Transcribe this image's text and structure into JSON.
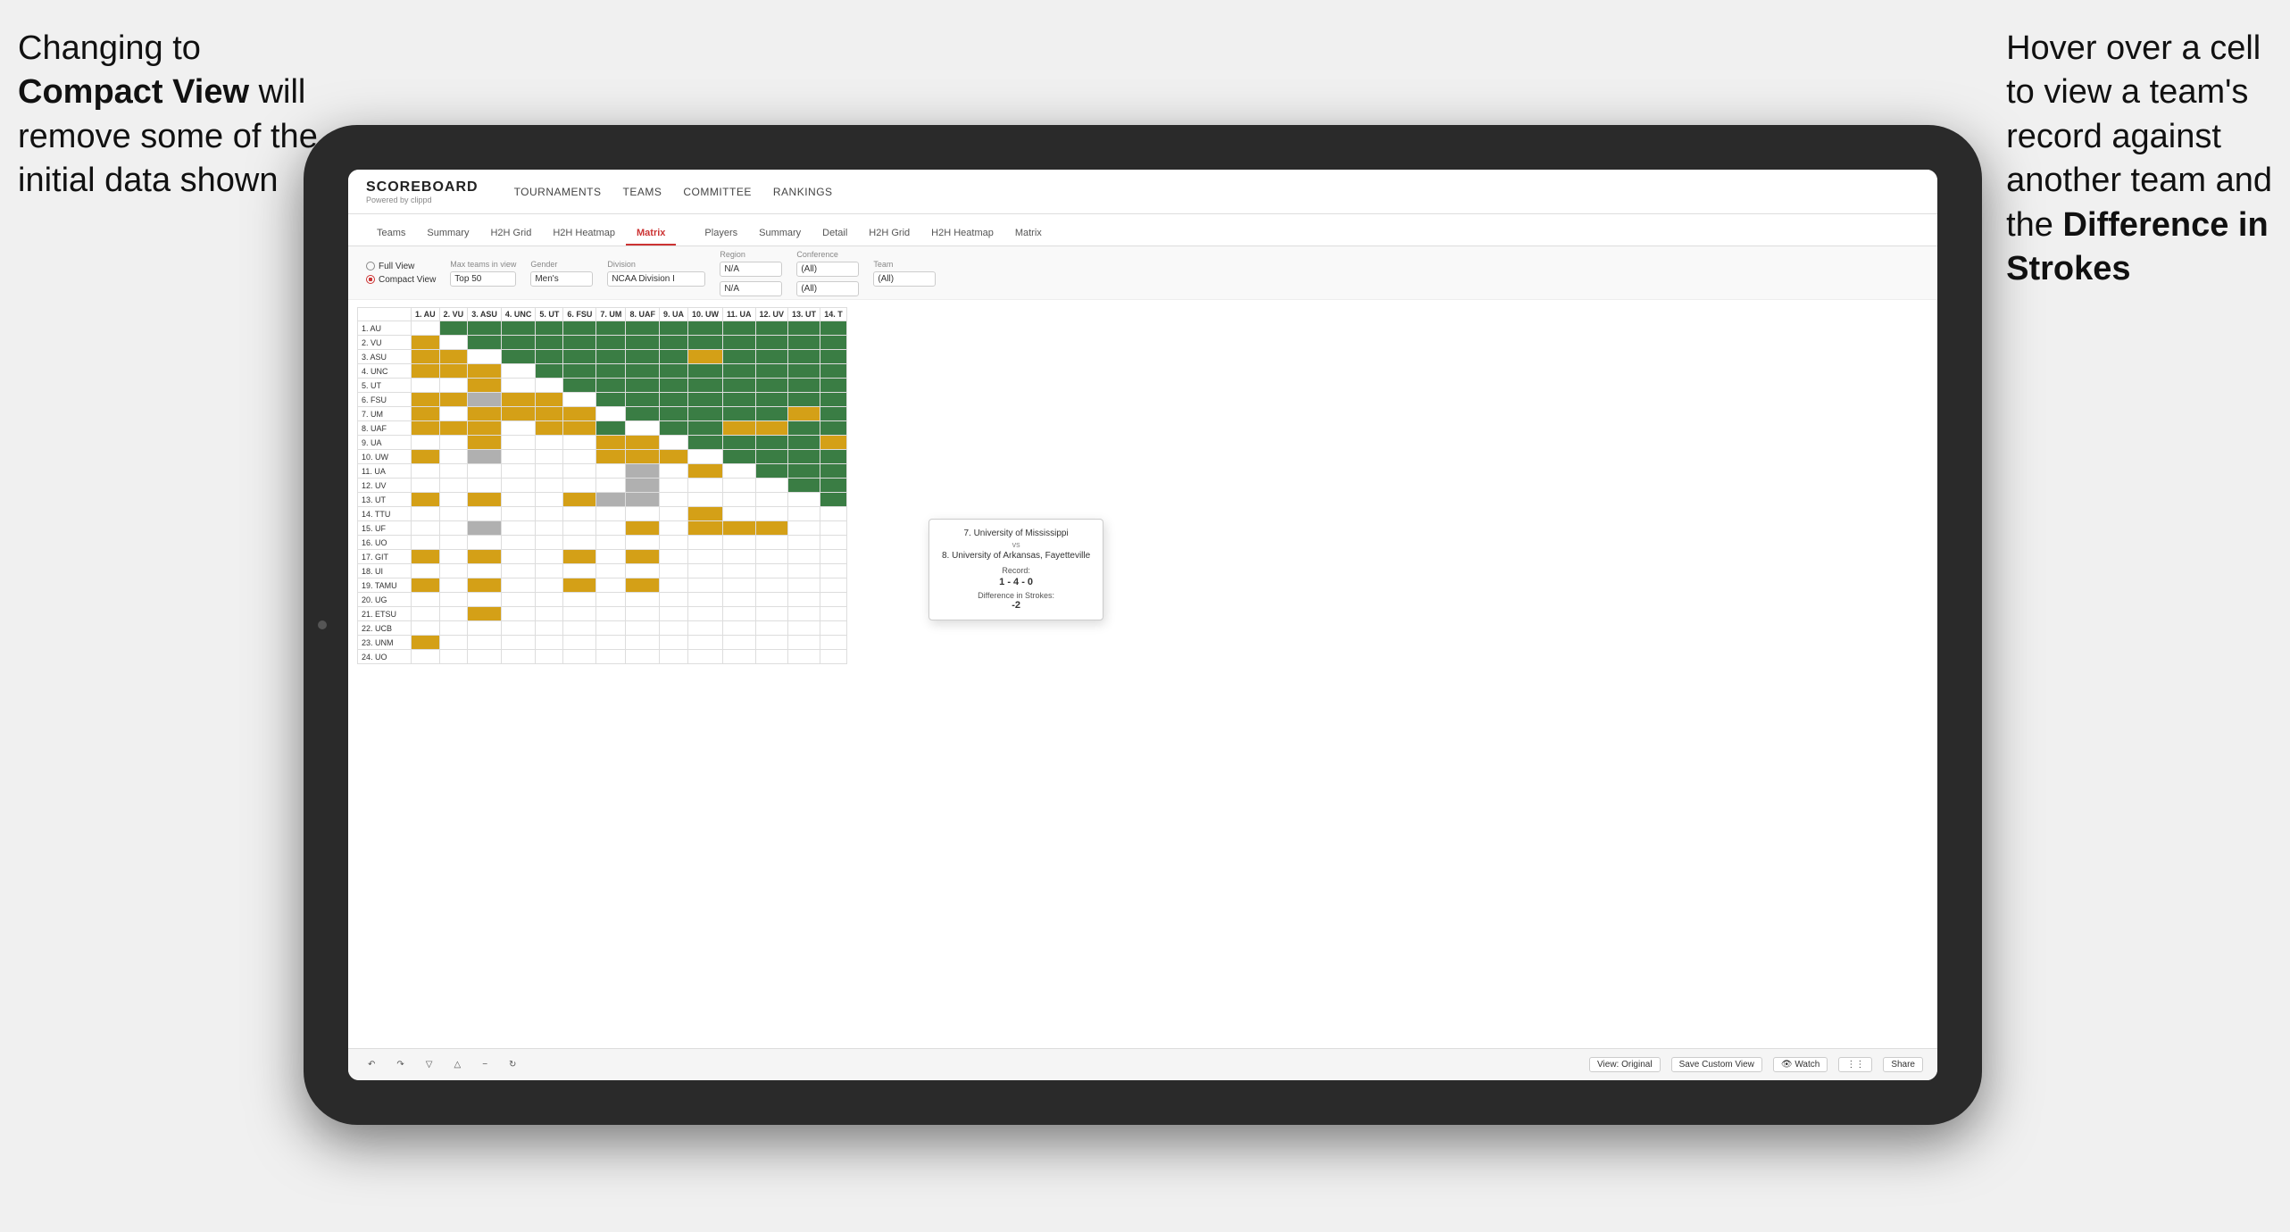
{
  "annotation_left": {
    "line1": "Changing to",
    "line2_bold": "Compact View",
    "line2_rest": " will",
    "line3": "remove some of the",
    "line4": "initial data shown"
  },
  "annotation_right": {
    "line1": "Hover over a cell",
    "line2": "to view a team's",
    "line3": "record against",
    "line4": "another team and",
    "line5_pre": "the ",
    "line5_bold": "Difference in",
    "line6_bold": "Strokes"
  },
  "navbar": {
    "logo": "SCOREBOARD",
    "logo_sub": "Powered by clippd",
    "nav_items": [
      "TOURNAMENTS",
      "TEAMS",
      "COMMITTEE",
      "RANKINGS"
    ]
  },
  "subnav": {
    "group1": [
      "Teams",
      "Summary",
      "H2H Grid",
      "H2H Heatmap",
      "Matrix"
    ],
    "group2": [
      "Players",
      "Summary",
      "Detail",
      "H2H Grid",
      "H2H Heatmap",
      "Matrix"
    ],
    "active": "Matrix"
  },
  "filters": {
    "view_full": "Full View",
    "view_compact": "Compact View",
    "selected_view": "compact",
    "max_teams_label": "Max teams in view",
    "max_teams_value": "Top 50",
    "gender_label": "Gender",
    "gender_value": "Men's",
    "division_label": "Division",
    "division_value": "NCAA Division I",
    "region_label": "Region",
    "region_value": "N/A",
    "conference_label": "Conference",
    "conference_values": [
      "(All)",
      "(All)"
    ],
    "team_label": "Team",
    "team_value": "(All)"
  },
  "column_headers": [
    "1. AU",
    "2. VU",
    "3. ASU",
    "4. UNC",
    "5. UT",
    "6. FSU",
    "7. UM",
    "8. UAF",
    "9. UA",
    "10. UW",
    "11. UA",
    "12. UV",
    "13. UT",
    "14. T"
  ],
  "row_labels": [
    "1. AU",
    "2. VU",
    "3. ASU",
    "4. UNC",
    "5. UT",
    "6. FSU",
    "7. UM",
    "8. UAF",
    "9. UA",
    "10. UW",
    "11. UA",
    "12. UV",
    "13. UT",
    "14. TTU",
    "15. UF",
    "16. UO",
    "17. GIT",
    "18. UI",
    "19. TAMU",
    "20. UG",
    "21. ETSU",
    "22. UCB",
    "23. UNM",
    "24. UO"
  ],
  "tooltip": {
    "team1": "7. University of Mississippi",
    "vs": "vs",
    "team2": "8. University of Arkansas, Fayetteville",
    "record_label": "Record:",
    "record_value": "1 - 4 - 0",
    "strokes_label": "Difference in Strokes:",
    "strokes_value": "-2"
  },
  "toolbar": {
    "view_original": "View: Original",
    "save_custom": "Save Custom View",
    "watch": "Watch",
    "share": "Share"
  }
}
